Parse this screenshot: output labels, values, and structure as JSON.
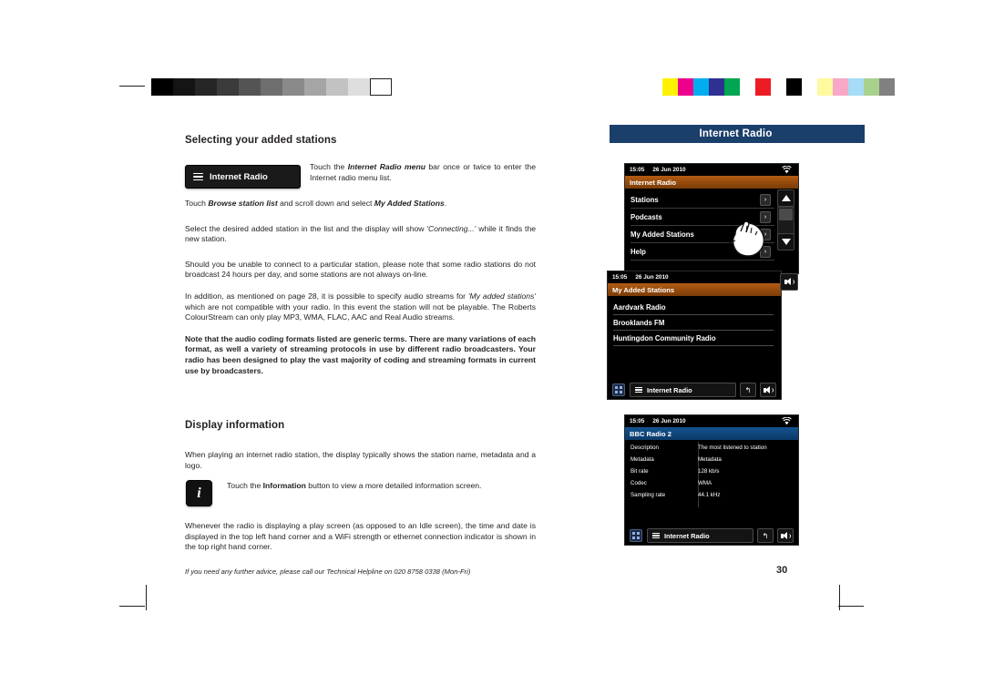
{
  "document": {
    "page_number": "30",
    "footnote": "If you need any further advice, please call our Technical Helpline on 020 8758 0338 (Mon-Fri)",
    "right_header_title": "Internet Radio"
  },
  "section1": {
    "heading": "Selecting your added stations",
    "chip_label": "Internet Radio",
    "chip_paragraph_pre": "Touch the ",
    "chip_paragraph_bold": "Internet Radio menu",
    "chip_paragraph_post": " bar once or twice to enter the Internet radio menu list.",
    "p2_pre": "Touch ",
    "p2_b1": "Browse station list",
    "p2_mid": " and scroll down and select ",
    "p2_b2": "My Added Stations",
    "p2_post": ".",
    "p3_pre": "Select the desired added station in the list and the display will show ",
    "p3_italic": "'Connecting...'",
    "p3_post": " while it finds the new station.",
    "p4": "Should you be unable to connect to a particular station, please note that some radio stations do not broadcast 24 hours per day, and some stations are not always on-line.",
    "p5_pre": "In addition, as mentioned on page 28, it is possible to specify audio streams  for ",
    "p5_italic": "'My added stations'",
    "p5_post": " which are not compatible with your radio. In this event the station will not be playable. The Roberts ColourStream can only play MP3, WMA, FLAC, AAC and Real Audio streams.",
    "p6_pre": "Note that the audio coding formats listed are generic terms. There are many variations of each format, as well a variety of streaming protocols in use by different radio broadcasters. Your radio has been designed to play the vast majority of coding and streaming formats in current use by broadcasters."
  },
  "section2": {
    "heading": "Display information",
    "p1": "When playing an internet radio station, the display typically shows the station name, metadata and a logo.",
    "info_icon_glyph": "i",
    "info_pre": "Touch the ",
    "info_bold": "Information",
    "info_post": " button to view a more detailed information screen.",
    "p2": "Whenever the radio is displaying a play screen (as opposed to an Idle screen), the time and date is displayed in the top left hand corner and a WiFi strength or ethernet connection indicator is shown in the top right hand corner."
  },
  "screens": {
    "menu": {
      "time": "15:05",
      "date": "26 Jun 2010",
      "title": "Internet Radio",
      "items": [
        {
          "label": "Stations",
          "chevron": "›"
        },
        {
          "label": "Podcasts",
          "chevron": "›"
        },
        {
          "label": "My Added Stations",
          "chevron": "›"
        },
        {
          "label": "Help",
          "chevron": "›"
        }
      ]
    },
    "added": {
      "time": "15:05",
      "date": "26 Jun 2010",
      "title": "My Added Stations",
      "items": [
        "Aardvark Radio",
        "Brooklands FM",
        "Huntingdon Community Radio"
      ],
      "bottom_bar_label": "Internet Radio",
      "back_glyph": "↰"
    },
    "info": {
      "time": "15:05",
      "date": "26 Jun 2010",
      "title": "BBC Radio 2",
      "rows": [
        {
          "key": "Description",
          "value": "The most listened to station"
        },
        {
          "key": "Metadata",
          "value": "Metadata"
        },
        {
          "key": "Bit rate",
          "value": "128 kb/s"
        },
        {
          "key": "Codec",
          "value": "WMA"
        },
        {
          "key": "Sampling rate",
          "value": "44.1 kHz"
        }
      ],
      "bottom_bar_label": "Internet Radio",
      "back_glyph": "↰"
    }
  },
  "calibration": {
    "greys": [
      "#000000",
      "#1b1b1b",
      "#333333",
      "#4d4d4d",
      "#666666",
      "#808080",
      "#999999",
      "#b3b3b3",
      "#cccccc",
      "#e6e6e6",
      "#ffffff"
    ],
    "colors": [
      "#ffffff",
      "#ffff00",
      "#ff00ff",
      "#00ffff",
      "#0000ff",
      "#00a651",
      "#ed1c24",
      "#000000",
      "#ffffff",
      "#fff79a",
      "#f9a8d4",
      "#9fd8f5",
      "#a8d08d",
      "#808080"
    ]
  }
}
